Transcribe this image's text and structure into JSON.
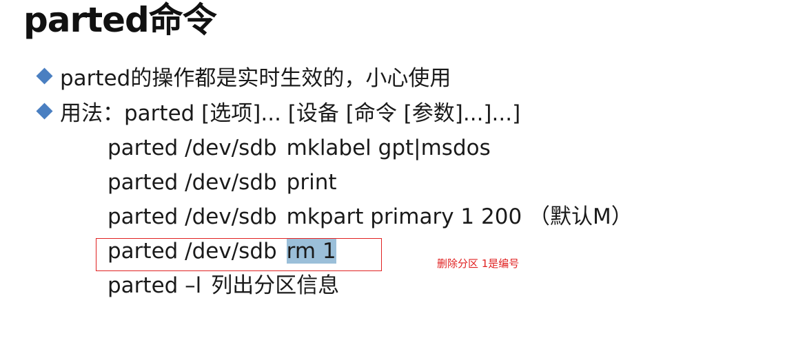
{
  "slide": {
    "title": "parted命令",
    "bullets": [
      "parted的操作都是实时生效的，小心使用",
      "用法：parted [选项]... [设备 [命令 [参数]...]...]"
    ],
    "commands": [
      {
        "device": "parted /dev/sdb",
        "action": "mklabel gpt|msdos"
      },
      {
        "device": "parted /dev/sdb",
        "action": "print"
      },
      {
        "device": "parted /dev/sdb",
        "action": "mkpart primary 1 200 （默认M）"
      },
      {
        "device": "parted /dev/sdb",
        "action": "rm 1"
      },
      {
        "device": "parted –l",
        "action": "列出分区信息"
      }
    ],
    "annotation": "删除分区 1是编号"
  },
  "colors": {
    "bullet": "#4a7fc1",
    "annotation": "#e02020",
    "highlight": "#9bbfd9"
  }
}
